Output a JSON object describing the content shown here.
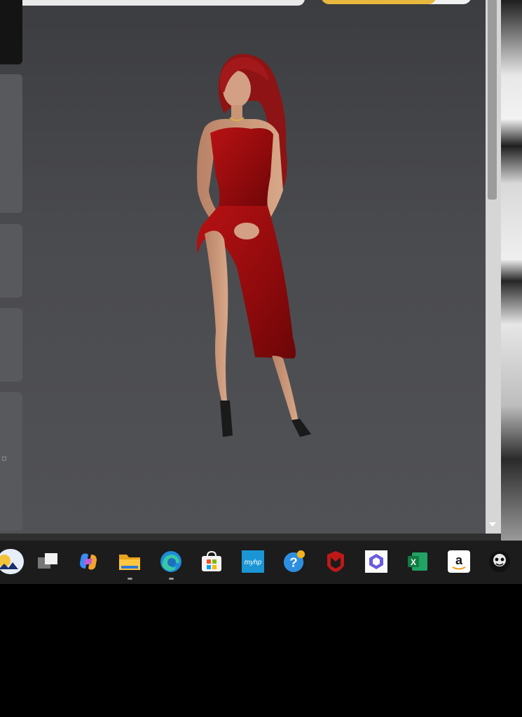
{
  "window": {
    "search_placeholder": "",
    "primary_button_label": ""
  },
  "avatar": {
    "description_icon": "3d-avatar-red-dress"
  },
  "taskbar": {
    "icons": [
      {
        "name": "weather-widget-icon"
      },
      {
        "name": "task-view-icon"
      },
      {
        "name": "copilot-icon"
      },
      {
        "name": "file-explorer-icon"
      },
      {
        "name": "edge-browser-icon"
      },
      {
        "name": "microsoft-store-icon"
      },
      {
        "name": "myhp-icon",
        "label": "myhp"
      },
      {
        "name": "help-icon"
      },
      {
        "name": "mcafee-icon"
      },
      {
        "name": "microsoft-365-icon"
      },
      {
        "name": "excel-icon",
        "label": "X"
      },
      {
        "name": "amazon-icon",
        "label": "a"
      },
      {
        "name": "imvu-icon"
      }
    ]
  },
  "colors": {
    "taskbar_bg": "#1c1c1c",
    "dress_red": "#a50d10",
    "accent_yellow": "#e8b73d"
  }
}
